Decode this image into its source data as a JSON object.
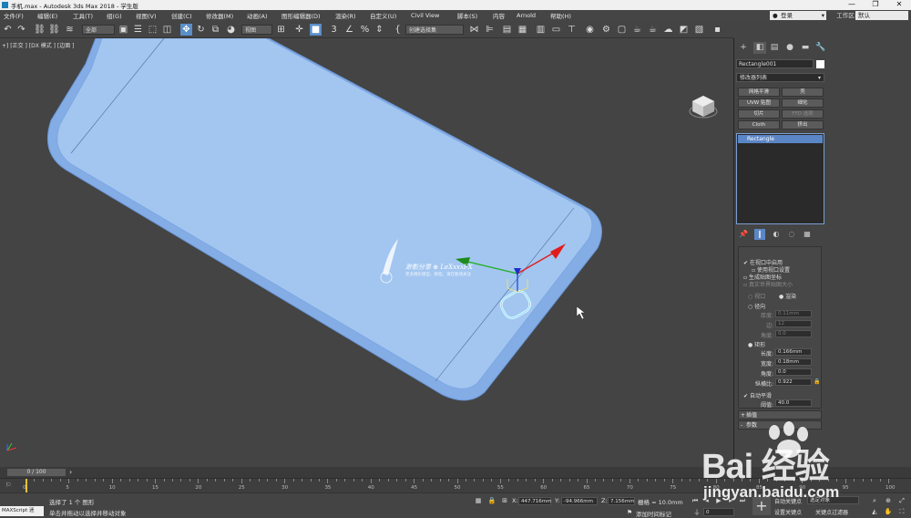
{
  "window": {
    "title": "手机.max - Autodesk 3ds Max 2018  - 学生版",
    "min": "—",
    "max": "❐",
    "close": "✕"
  },
  "menu": [
    "文件(F)",
    "编辑(E)",
    "工具(T)",
    "组(G)",
    "视图(V)",
    "创建(C)",
    "修改器(M)",
    "动画(A)",
    "图形编辑器(D)",
    "渲染(R)",
    "自定义(U)",
    "Civil View",
    "脚本(S)",
    "内容",
    "Arnold",
    "帮助(H)"
  ],
  "account": {
    "sign_in": "登录",
    "workspace_label": "工作区:",
    "workspace_value": "默认"
  },
  "toolbar": {
    "selection_filter": "全部",
    "ref_coord": "视图",
    "named_selection": "创建选择集"
  },
  "viewport": {
    "label": "+] [正交 ] [DX 模式 ] [边面 ]",
    "watermark_text": "渺影分享 ⊕ LeXxxxFX",
    "watermark_sub": "更多精彩模型、教程，请在敬请关注"
  },
  "command_panel": {
    "object_name": "Rectangle001",
    "object_color": "#ffffff",
    "modifier_list": "修改器列表",
    "modifier_buttons": [
      {
        "label": "网格平滑",
        "enabled": true
      },
      {
        "label": "壳",
        "enabled": true
      },
      {
        "label": "UVW 贴图",
        "enabled": true
      },
      {
        "label": "细化",
        "enabled": true
      },
      {
        "label": "切片",
        "enabled": true
      },
      {
        "label": "FFD 选择",
        "enabled": false
      },
      {
        "label": "Cloth",
        "enabled": true
      },
      {
        "label": "挤出",
        "enabled": true
      }
    ],
    "stack_item": "Rectangle",
    "rendering": {
      "enable_in_viewport": "在视口中启用",
      "use_viewport_settings": "使用视口设置",
      "gen_mapping": "生成贴图坐标",
      "real_world": "真实世界贴图大小",
      "viewport_opt": "视口",
      "render_opt": "渲染",
      "radial": "径向",
      "thickness_lbl": "厚度:",
      "thickness_val": "0.11mm",
      "sides_lbl": "边:",
      "sides_val": "12",
      "angle_lbl": "角度:",
      "angle_val": "0.0",
      "rectangular": "矩形",
      "length_lbl": "长度:",
      "length_val": "0.166mm",
      "width_lbl": "宽度:",
      "width_val": "0.18mm",
      "angle2_lbl": "角度:",
      "angle2_val": "0.0",
      "aspect_lbl": "纵横比:",
      "aspect_val": "0.922",
      "auto_smooth": "自动平滑",
      "threshold_lbl": "阈值:",
      "threshold_val": "40.0"
    },
    "interpolation": "插值",
    "parameters": "参数"
  },
  "timeline": {
    "frame": "0 / 100",
    "ticks": [
      "0",
      "5",
      "10",
      "15",
      "20",
      "25",
      "30",
      "35",
      "40",
      "45",
      "50",
      "55",
      "60",
      "65",
      "70",
      "75",
      "80",
      "85",
      "90",
      "95",
      "100"
    ]
  },
  "status": {
    "maxscript": "MAXScript 迷",
    "selected": "选择了 1 个 图形",
    "prompt": "单击并拖动以选择并移动对象",
    "x": "447.716mm",
    "y": "-94.966mm",
    "z": "7.156mm",
    "grid": "栅格 = 10.0mm",
    "add_time_tag": "添加时间标记",
    "auto_key": "自动关键点",
    "set_key": "设置关键点",
    "selected_obj": "选定对象",
    "key_filter": "关键点过滤器",
    "frame_val": "0"
  },
  "baidu": {
    "brand": "Bai 经验",
    "url": "jingyan.baidu.com"
  },
  "colors": {
    "model_fill": "#a3c6f0",
    "model_edge": "#6f9fdc",
    "selection_blue": "#5b86c6"
  }
}
